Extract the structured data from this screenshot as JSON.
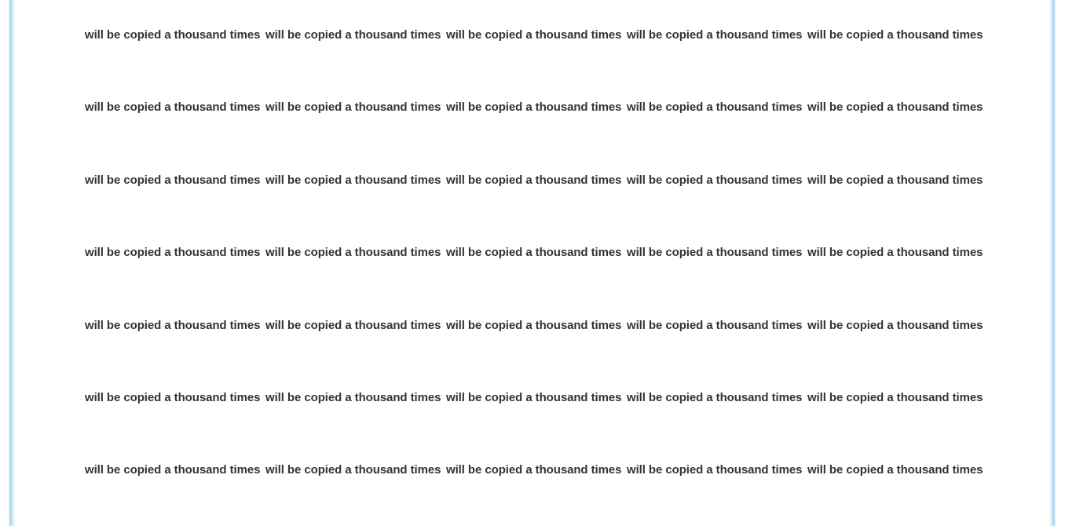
{
  "items": {
    "r0c0": "will be copied a thousand times",
    "r0c1": "will be copied a thousand times",
    "r0c2": "will be copied a thousand times",
    "r0c3": "will be copied a thousand times",
    "r0c4": "will be copied a thousand times",
    "r1c0": "will be copied a thousand times",
    "r1c1": "will be copied a thousand times",
    "r1c2": "will be copied a thousand times",
    "r1c3": "will be copied a thousand times",
    "r1c4": "will be copied a thousand times",
    "r2c0": "will be copied a thousand times",
    "r2c1": "will be copied a thousand times",
    "r2c2": "will be copied a thousand times",
    "r2c3": "will be copied a thousand times",
    "r2c4": "will be copied a thousand times",
    "r3c0": "will be copied a thousand times",
    "r3c1": "will be copied a thousand times",
    "r3c2": "will be copied a thousand times",
    "r3c3": "will be copied a thousand times",
    "r3c4": "will be copied a thousand times",
    "r4c0": "will be copied a thousand times",
    "r4c1": "will be copied a thousand times",
    "r4c2": "will be copied a thousand times",
    "r4c3": "will be copied a thousand times",
    "r4c4": "will be copied a thousand times",
    "r5c0": "will be copied a thousand times",
    "r5c1": "will be copied a thousand times",
    "r5c2": "will be copied a thousand times",
    "r5c3": "will be copied a thousand times",
    "r5c4": "will be copied a thousand times",
    "r6c0": "will be copied a thousand times",
    "r6c1": "will be copied a thousand times",
    "r6c2": "will be copied a thousand times",
    "r6c3": "will be copied a thousand times",
    "r6c4": "will be copied a thousand times"
  },
  "colors": {
    "text": "#333333",
    "background": "#ffffff",
    "edge_accent": "#9fcdec"
  }
}
